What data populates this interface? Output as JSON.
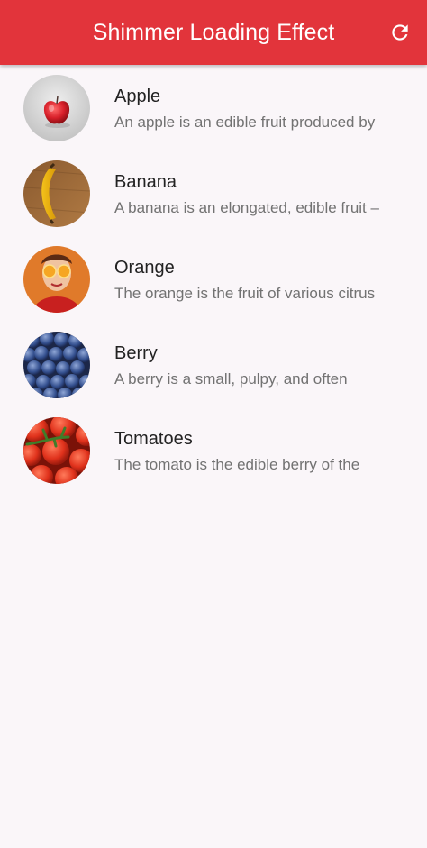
{
  "app_bar": {
    "title": "Shimmer Loading Effect",
    "action_icon": "refresh-icon",
    "color": "#e2343b"
  },
  "list": {
    "items": [
      {
        "title": "Apple",
        "subtitle": "An apple is an edible fruit produced by",
        "image": "apple-image"
      },
      {
        "title": "Banana",
        "subtitle": "A banana is an elongated, edible fruit –",
        "image": "banana-image"
      },
      {
        "title": "Orange",
        "subtitle": "The orange is the fruit of various citrus",
        "image": "orange-image"
      },
      {
        "title": "Berry",
        "subtitle": "A berry is a small, pulpy, and often",
        "image": "berry-image"
      },
      {
        "title": "Tomatoes",
        "subtitle": "The tomato is the edible berry of the",
        "image": "tomato-image"
      }
    ]
  }
}
